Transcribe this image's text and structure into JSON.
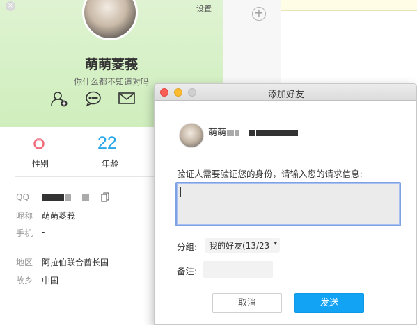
{
  "profile": {
    "settings_label": "设置",
    "nickname": "萌萌菱莪",
    "signature": "你什么都不知道对吗",
    "stats": {
      "gender_label": "性别",
      "age_value": "22",
      "age_label": "年龄"
    },
    "info": [
      {
        "label": "QQ",
        "value": ""
      },
      {
        "label": "昵称",
        "value": "萌萌菱莪"
      },
      {
        "label": "手机",
        "value": "-"
      },
      {
        "label": "地区",
        "value": "阿拉伯联合酋长国"
      },
      {
        "label": "故乡",
        "value": "中国"
      }
    ]
  },
  "dialog": {
    "title": "添加好友",
    "user_name_prefix": "萌萌",
    "prompt": "验证人需要验证您的身份，请输入您的请求信息:",
    "message_value": "",
    "group_label": "分组:",
    "group_value": "我的好友(13/23",
    "remark_label": "备注:",
    "remark_value": "",
    "cancel_label": "取消",
    "send_label": "发送"
  },
  "colors": {
    "header_green": "#d6f0c6",
    "age_blue": "#2aa7e8",
    "send_blue": "#12a3f5",
    "focus_border": "#7ea1e6"
  },
  "icons": [
    "close-icon",
    "add-friend-icon",
    "chat-icon",
    "mail-icon",
    "gender-female-icon",
    "copy-icon",
    "plus-icon"
  ]
}
